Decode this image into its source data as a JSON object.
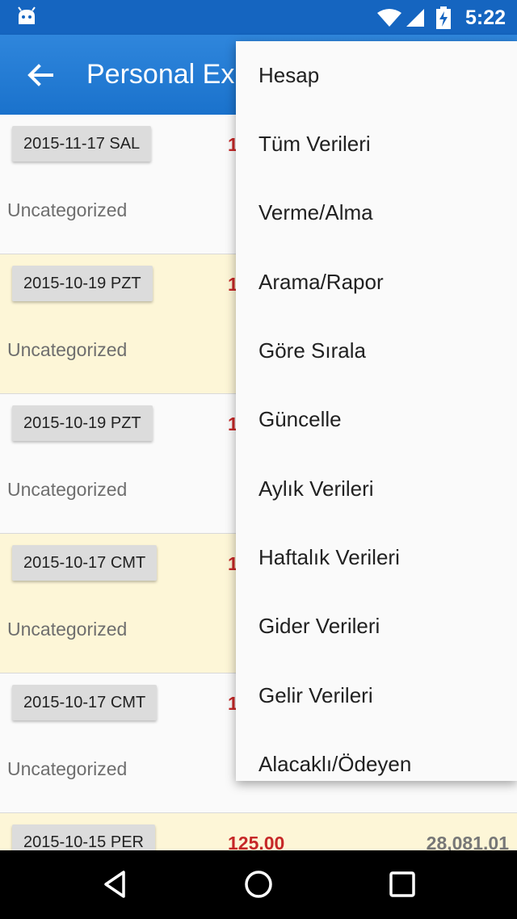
{
  "status_bar": {
    "time": "5:22",
    "icons": [
      "android-icon",
      "wifi-icon",
      "signal-icon",
      "battery-charging-icon"
    ]
  },
  "app_bar": {
    "title": "Personal Ex",
    "back_icon": "back-arrow-icon"
  },
  "list": {
    "rows": [
      {
        "date": "2015-11-17 SAL",
        "amount": "1",
        "category": "Uncategorized"
      },
      {
        "date": "2015-10-19 PZT",
        "amount": "1",
        "category": "Uncategorized"
      },
      {
        "date": "2015-10-19 PZT",
        "amount": "1",
        "category": "Uncategorized"
      },
      {
        "date": "2015-10-17 CMT",
        "amount": "1",
        "category": "Uncategorized"
      },
      {
        "date": "2015-10-17 CMT",
        "amount": "1",
        "category": "Uncategorized"
      },
      {
        "date": "2015-10-15 PER",
        "amount": "125.00",
        "balance": "28,081.01"
      }
    ]
  },
  "menu": {
    "items": [
      "Hesap",
      "Tüm Verileri",
      "Verme/Alma",
      "Arama/Rapor",
      "Göre Sırala",
      "Güncelle",
      "Aylık Verileri",
      "Haftalık Verileri",
      "Gider Verileri",
      "Gelir Verileri",
      "Alacaklı/Ödeyen"
    ]
  },
  "nav_bar": {
    "icons": [
      "back-triangle-icon",
      "home-circle-icon",
      "recents-square-icon"
    ]
  },
  "colors": {
    "status_bar": "#1565c0",
    "app_bar": "#1976d2",
    "amount": "#c62828",
    "alt_row": "#fdf6d7"
  }
}
